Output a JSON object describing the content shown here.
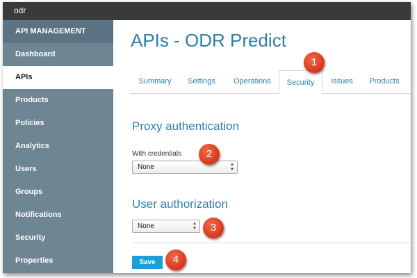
{
  "app": {
    "name": "odr"
  },
  "sidebar": {
    "heading": "API MANAGEMENT",
    "items": [
      {
        "label": "Dashboard",
        "active": false
      },
      {
        "label": "APIs",
        "active": true
      },
      {
        "label": "Products",
        "active": false
      },
      {
        "label": "Policies",
        "active": false
      },
      {
        "label": "Analytics",
        "active": false
      },
      {
        "label": "Users",
        "active": false
      },
      {
        "label": "Groups",
        "active": false
      },
      {
        "label": "Notifications",
        "active": false
      },
      {
        "label": "Security",
        "active": false
      },
      {
        "label": "Properties",
        "active": false
      }
    ]
  },
  "main": {
    "title": "APIs - ODR Predict",
    "tabs": [
      {
        "label": "Summary",
        "active": false
      },
      {
        "label": "Settings",
        "active": false
      },
      {
        "label": "Operations",
        "active": false
      },
      {
        "label": "Security",
        "active": true
      },
      {
        "label": "Issues",
        "active": false
      },
      {
        "label": "Products",
        "active": false
      }
    ],
    "proxy_auth": {
      "title": "Proxy authentication",
      "field_label": "With credentials",
      "selected": "None"
    },
    "user_auth": {
      "title": "User authorization",
      "selected": "None"
    },
    "save_label": "Save"
  },
  "callouts": [
    "1",
    "2",
    "3",
    "4"
  ],
  "colors": {
    "accent": "#2d7fa8",
    "sidebar": "#6e8594",
    "topbar": "#3a3a3a",
    "save_button": "#1c9fd6",
    "callout": "#d8341a"
  }
}
